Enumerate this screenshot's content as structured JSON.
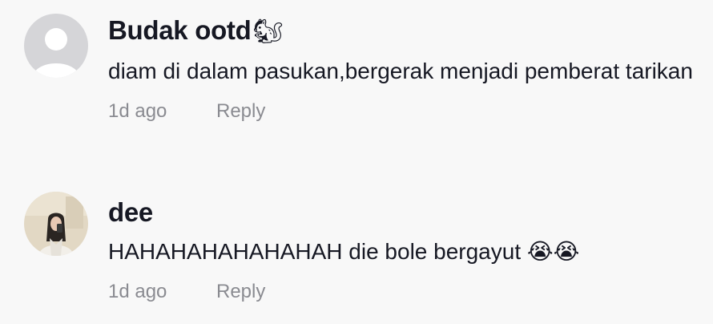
{
  "comments": [
    {
      "username": "Budak ootd",
      "username_emoji": "🐿",
      "avatar": "default-avatar-icon",
      "text": "diam di dalam pasukan,bergerak menjadi pemberat tarikan",
      "time": "1d ago",
      "reply_label": "Reply"
    },
    {
      "username": "dee",
      "username_emoji": "",
      "avatar": "photo-avatar",
      "text": "HAHAHAHAHAHAHAH die bole bergayut 😭😭",
      "time": "1d ago",
      "reply_label": "Reply"
    }
  ]
}
